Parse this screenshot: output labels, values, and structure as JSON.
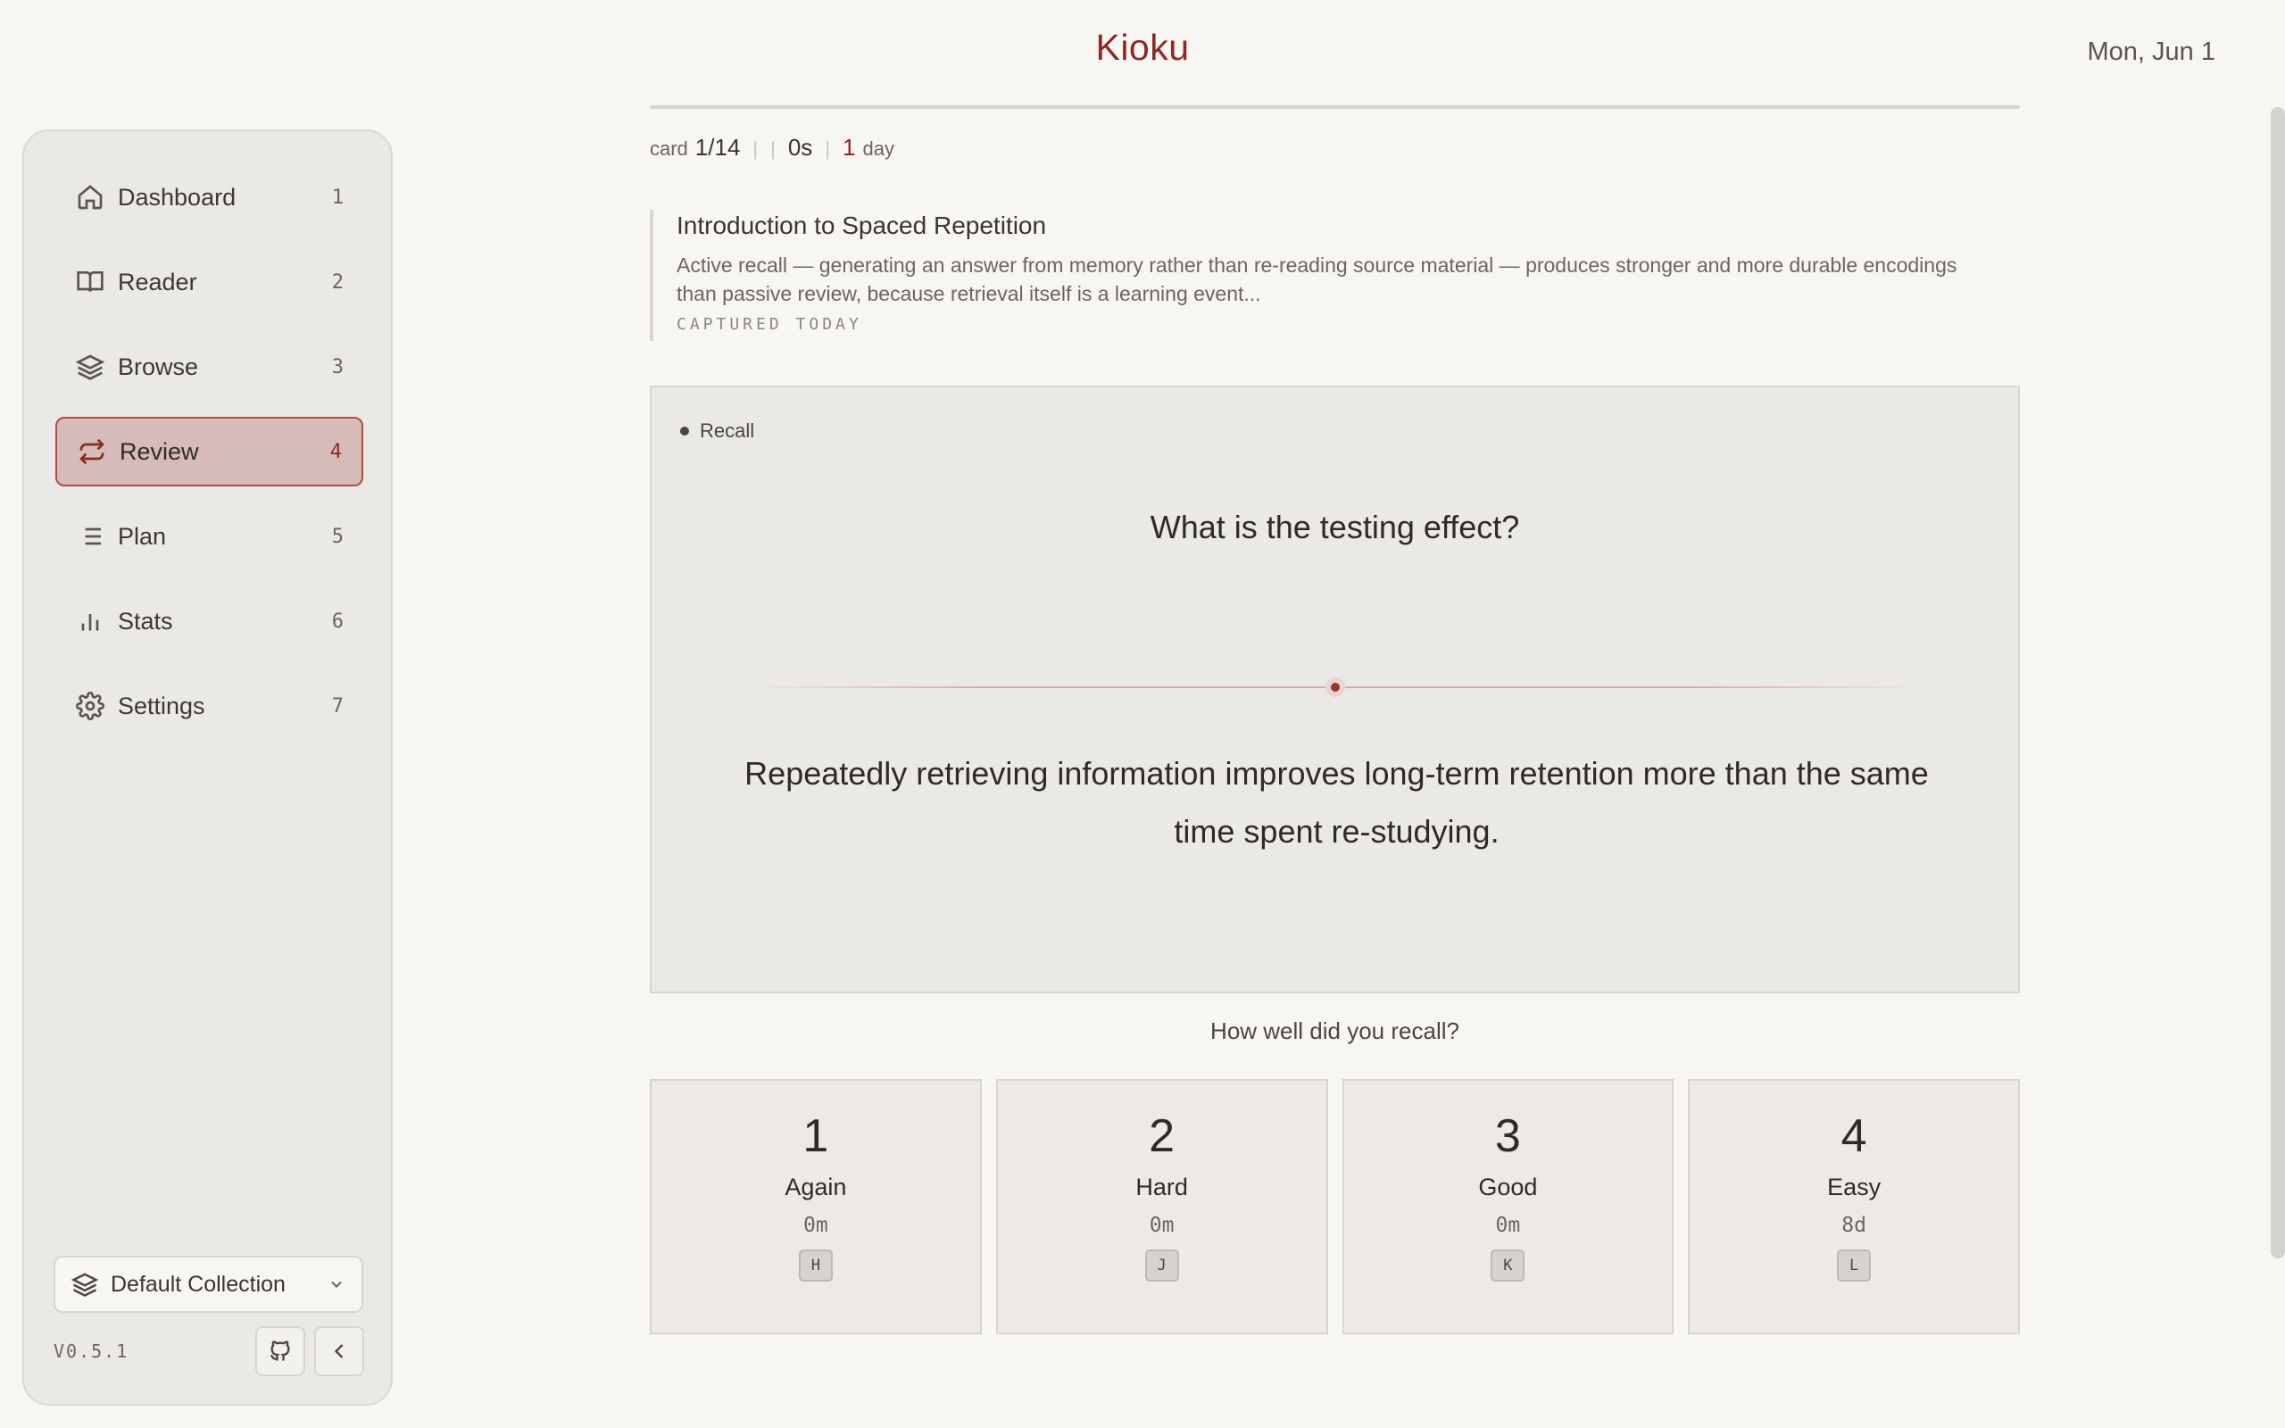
{
  "header": {
    "title": "Kioku",
    "date": "Mon, Jun 1"
  },
  "sidebar": {
    "items": [
      {
        "label": "Dashboard",
        "num": "1",
        "icon": "home-icon"
      },
      {
        "label": "Reader",
        "num": "2",
        "icon": "book-icon"
      },
      {
        "label": "Browse",
        "num": "3",
        "icon": "layers-icon"
      },
      {
        "label": "Review",
        "num": "4",
        "icon": "repeat-icon",
        "active": true
      },
      {
        "label": "Plan",
        "num": "5",
        "icon": "list-icon"
      },
      {
        "label": "Stats",
        "num": "6",
        "icon": "bar-chart-icon"
      },
      {
        "label": "Settings",
        "num": "7",
        "icon": "gear-icon"
      }
    ],
    "collection": "Default Collection",
    "version": "V0.5.1"
  },
  "meta": {
    "card_prefix": "card",
    "card_count": "1/14",
    "sep": "|",
    "elapsed": "0s",
    "interval_num": "1",
    "interval_unit": "day"
  },
  "source": {
    "title": "Introduction to Spaced Repetition",
    "excerpt": "Active recall — generating an answer from memory rather than re-reading source material — produces stronger and more durable encodings than passive review, because retrieval itself is a learning event...",
    "caption": "CAPTURED TODAY"
  },
  "card": {
    "tag": "Recall",
    "question": "What is the testing effect?",
    "answer": "Repeatedly retrieving information improves long-term retention more than the same time spent re-studying."
  },
  "recall": {
    "prompt": "How well did you recall?",
    "grades": [
      {
        "num": "1",
        "label": "Again",
        "time": "0m",
        "key": "H"
      },
      {
        "num": "2",
        "label": "Hard",
        "time": "0m",
        "key": "J"
      },
      {
        "num": "3",
        "label": "Good",
        "time": "0m",
        "key": "K"
      },
      {
        "num": "4",
        "label": "Easy",
        "time": "8d",
        "key": "L"
      }
    ]
  },
  "colors": {
    "accent": "#8b2a24",
    "background": "#f8f6f2",
    "panel": "#ebe9e5"
  }
}
